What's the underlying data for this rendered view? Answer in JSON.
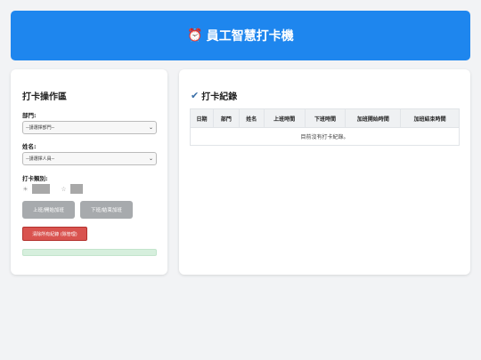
{
  "header": {
    "icon": "alarm-clock-icon",
    "title": "員工智慧打卡機"
  },
  "left": {
    "title": "打卡操作區",
    "department_label": "部門:",
    "department_value": "--請選擇部門--",
    "person_label": "姓名:",
    "person_value": "--請選擇人員--",
    "type_label": "打卡類別:",
    "btn_clock_in": "上班/開始加班",
    "btn_clock_out": "下班/結束加班",
    "btn_clear": "清除所有紀錄 (除管理)"
  },
  "right": {
    "title": "打卡紀錄",
    "columns": [
      "日期",
      "部門",
      "姓名",
      "上班時間",
      "下班時間",
      "加班開始時間",
      "加班結束時間"
    ],
    "empty_message": "目前沒有打卡紀錄。"
  },
  "colors": {
    "header_bg": "#1e86ee",
    "danger": "#d9534f",
    "disabled": "#a7aaad",
    "progress": "#d6efdd"
  }
}
